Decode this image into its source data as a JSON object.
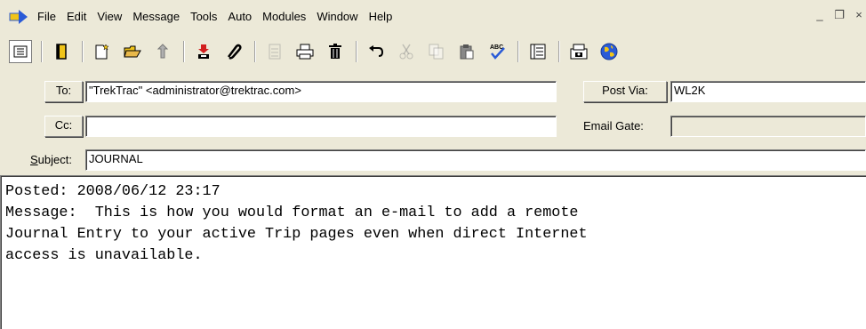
{
  "menu": {
    "items": [
      "File",
      "Edit",
      "View",
      "Message",
      "Tools",
      "Auto",
      "Modules",
      "Window",
      "Help"
    ]
  },
  "window_controls": {
    "minimize": "_",
    "restore": "❐",
    "close": "×"
  },
  "toolbar": {
    "buttons": [
      "address-book-icon",
      "save-icon",
      "new-message-icon",
      "open-icon",
      "reply-icon",
      "receive-icon",
      "attach-icon",
      "form-icon",
      "print-icon",
      "delete-icon",
      "undo-icon",
      "cut-icon",
      "copy-icon",
      "paste-icon",
      "spellcheck-icon",
      "catalog-icon",
      "fax-icon",
      "globe-icon"
    ]
  },
  "header": {
    "to_label": "To:",
    "to_value": "\"TrekTrac\" <administrator@trektrac.com>",
    "cc_label": "Cc:",
    "cc_value": "",
    "subject_label": "Subject:",
    "subject_value": "JOURNAL",
    "post_via_label": "Post Via:",
    "post_via_value": "WL2K",
    "email_gate_label": "Email Gate:",
    "email_gate_value": ""
  },
  "body": {
    "lines": [
      "Posted: 2008/06/12 23:17",
      "Message:  This is how you would format an e-mail to add a remote",
      "Journal Entry to your active Trip pages even when direct Internet",
      "access is unavailable."
    ]
  },
  "colors": {
    "chrome": "#ece9d8",
    "field": "#ffffff",
    "app_icon_arrow": "#2a5bd7",
    "app_icon_fill": "#f0c419"
  }
}
